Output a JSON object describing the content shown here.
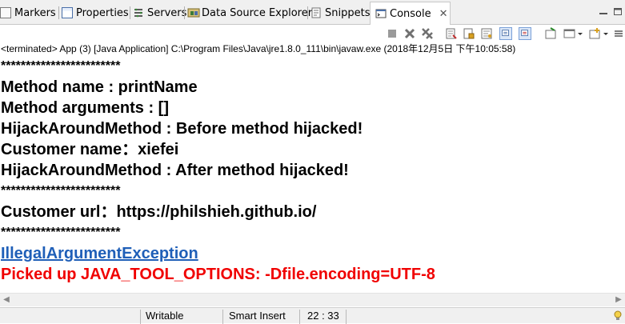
{
  "tabs": [
    {
      "label": "Markers",
      "icon": "markers-icon"
    },
    {
      "label": "Properties",
      "icon": "properties-icon"
    },
    {
      "label": "Servers",
      "icon": "servers-icon"
    },
    {
      "label": "Data Source Explorer",
      "icon": "data-source-icon"
    },
    {
      "label": "Snippets",
      "icon": "snippets-icon"
    },
    {
      "label": "Console",
      "icon": "console-icon",
      "active": true,
      "close": "✕"
    }
  ],
  "status_line": "<terminated> App (3) [Java Application] C:\\Program Files\\Java\\jre1.8.0_111\\bin\\javaw.exe (2018年12月5日 下午10:05:58)",
  "console": {
    "lines": [
      {
        "text": "************************",
        "kind": "stars"
      },
      {
        "text": "Method name : printName",
        "kind": "normal"
      },
      {
        "text": "Method arguments : []",
        "kind": "normal"
      },
      {
        "text": "HijackAroundMethod : Before method hijacked!",
        "kind": "normal"
      },
      {
        "text": "Customer name：xiefei",
        "kind": "normal"
      },
      {
        "text": "HijackAroundMethod : After method hijacked!",
        "kind": "normal"
      },
      {
        "text": "************************",
        "kind": "stars"
      },
      {
        "text": "Customer url：https://philshieh.github.io/",
        "kind": "normal"
      },
      {
        "text": "************************",
        "kind": "stars"
      },
      {
        "text": "IllegalArgumentException",
        "kind": "link"
      },
      {
        "text": "Picked up JAVA_TOOL_OPTIONS: -Dfile.encoding=UTF-8",
        "kind": "error"
      }
    ]
  },
  "statusbar": {
    "mode": "Writable",
    "insert": "Smart Insert",
    "position": "22 : 33"
  },
  "colors": {
    "link": "#1f5fb8",
    "error": "#f00000"
  }
}
